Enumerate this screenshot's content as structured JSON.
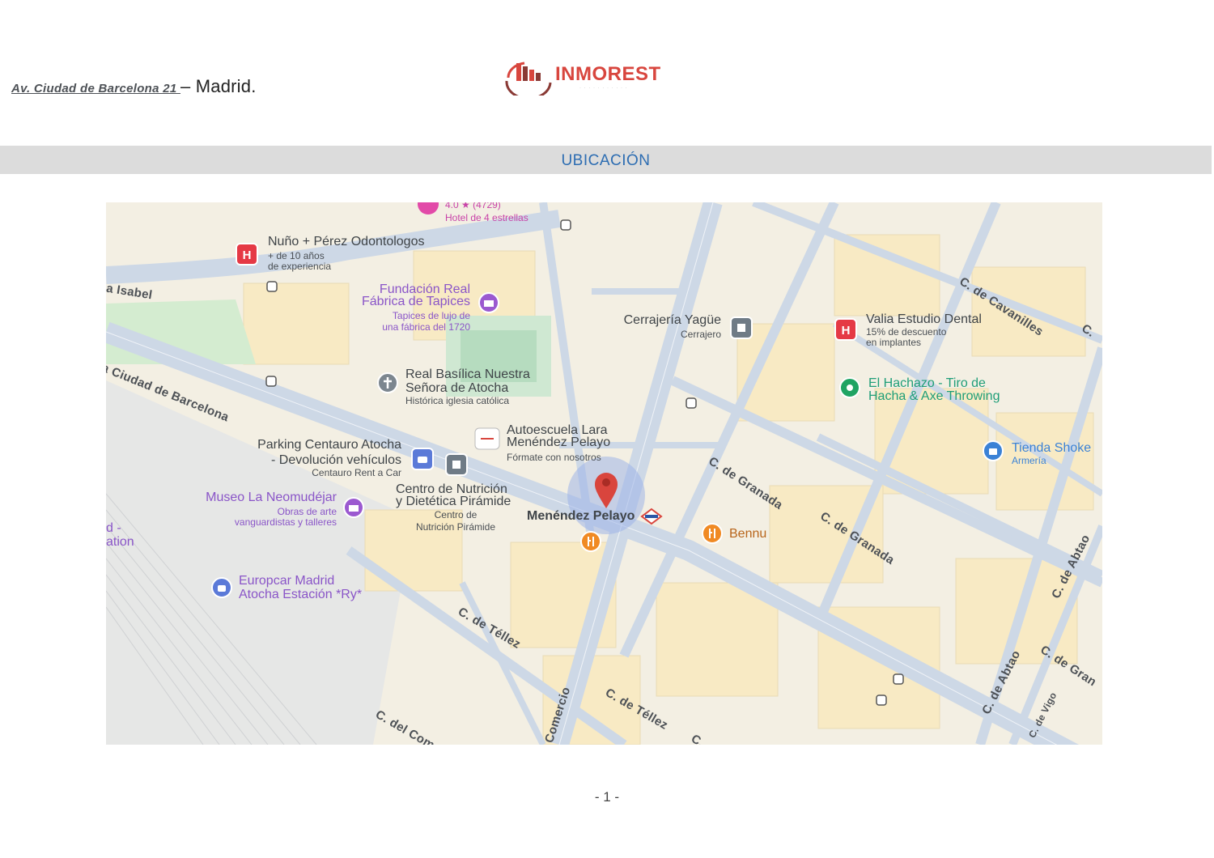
{
  "header": {
    "address_street": "Av. Ciudad de Barcelona 21 ",
    "address_city": "– Madrid.",
    "logo_text": "INMOREST"
  },
  "section": {
    "title": "UBICACIÓN"
  },
  "map": {
    "pois": {
      "hotel_rating": "4.0 ★ (4729)",
      "hotel_type": "Hotel de 4 estrellas",
      "nuno_name": "Nuño + Pérez Odontologos",
      "nuno_sub1": "+ de 10 años",
      "nuno_sub2": "de experiencia",
      "fundacion_name1": "Fundación Real",
      "fundacion_name2": "Fábrica de Tapices",
      "fundacion_sub1": "Tapices de lujo de",
      "fundacion_sub2": "una fábrica del 1720",
      "cerrajeria_name": "Cerrajería Yagüe",
      "cerrajeria_sub": "Cerrajero",
      "valia_name": "Valia Estudio Dental",
      "valia_sub1": "15% de descuento",
      "valia_sub2": "en implantes",
      "basilica_name1": "Real Basílica Nuestra",
      "basilica_name2": "Señora de Atocha",
      "basilica_sub": "Histórica iglesia católica",
      "hachazo_name1": "El Hachazo - Tiro de",
      "hachazo_name2": "Hacha & Axe Throwing",
      "autoescuela_name1": "Autoescuela Lara",
      "autoescuela_name2": "Menéndez Pelayo",
      "autoescuela_sub": "Fórmate con nosotros",
      "parking_name1": "Parking Centauro Atocha",
      "parking_name2": "- Devolución vehículos",
      "parking_sub": "Centauro Rent a Car",
      "tienda_name": "Tienda Shoke",
      "tienda_sub": "Armería",
      "museo_name": "Museo La Neomudéjar",
      "museo_sub1": "Obras de arte",
      "museo_sub2": "vanguardistas y talleres",
      "centro_name1": "Centro de Nutrición",
      "centro_name2": "y Dietética Pirámide",
      "centro_sub1": "Centro de",
      "centro_sub2": "Nutrición Pirámide",
      "metro_name": "Menéndez Pelayo",
      "bennu_name": "Bennu",
      "europcar_name1": "Europcar Madrid",
      "europcar_name2": "Atocha Estación *Ry*",
      "edge_frag1": "d -",
      "edge_frag2": "ation"
    },
    "streets": {
      "isabel": "a Isabel",
      "ciudad_barcelona": "la Ciudad de Barcelona",
      "cavanilles": "C. de Cavanilles",
      "cavanilles_edge": "C.",
      "granada1": "C. de Granada",
      "granada2": "C. de Granada",
      "granada3": "C. de Gran",
      "abtao1": "C. de Abtao",
      "abtao2": "C. de Abtao",
      "vigo": "C. de Vigo",
      "tellez1": "C. de Téllez",
      "tellez2": "C. de Téllez",
      "comercio1": "Comercio",
      "comercio2": "C. del Com",
      "frag_c": "C."
    },
    "icons": [
      "hospital-icon",
      "bus-stop-icon",
      "museum-icon",
      "church-icon",
      "parking-icon",
      "car-rental-icon",
      "shop-icon",
      "restaurant-icon",
      "metro-icon",
      "location-pin-icon"
    ],
    "colors": {
      "map_bg": "#f3efe3",
      "road": "#cdd8e6",
      "pin": "#d9453d",
      "hospital": "#e53945"
    }
  },
  "footer": {
    "page": "- 1 -"
  }
}
